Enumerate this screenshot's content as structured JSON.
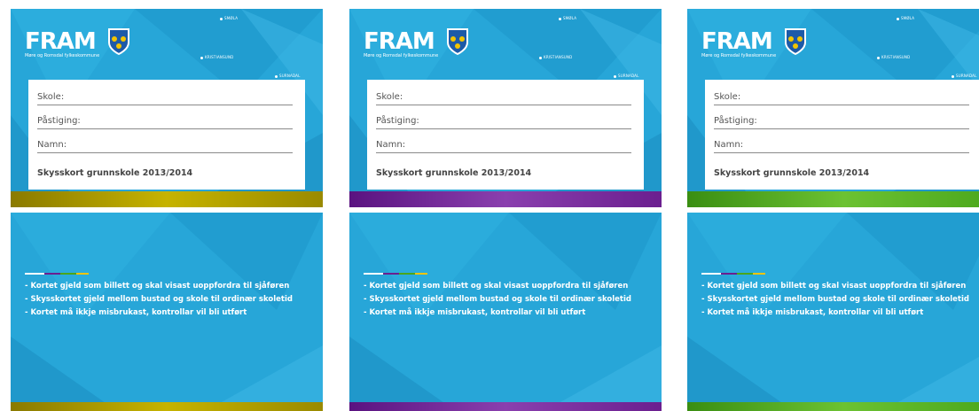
{
  "front": {
    "logo_text": "FRAM",
    "logo_sub": "Møre og Romsdal fylkeskommune",
    "places": [
      "SMØLA",
      "KRISTIANSUND",
      "SURNADAL"
    ],
    "fields": [
      "Skole:",
      "Påstiging:",
      "Namn:"
    ],
    "title": "Skysskort grunnskole 2013/2014"
  },
  "back": {
    "rules": [
      "- Kortet gjeld som billett og skal visast uoppfordra til sjåføren",
      "- Skysskortet gjeld mellom bustad og skole til ordinær skoletid",
      "- Kortet må ikkje misbrukast, kontrollar vil bli utført"
    ]
  },
  "variants": [
    {
      "color": "#9a8a00",
      "color_light": "#c6b300"
    },
    {
      "color": "#6b1f8f",
      "color_light": "#8a3fae"
    },
    {
      "color": "#4aa61b",
      "color_light": "#6cc232"
    }
  ],
  "colors": {
    "background": "#27a6d8"
  }
}
